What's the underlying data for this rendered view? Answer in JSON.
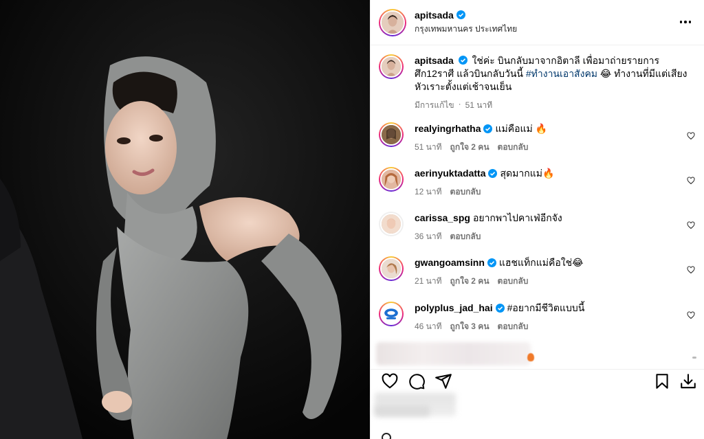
{
  "post": {
    "username": "apitsada",
    "location": "กรุงเทพมหานคร ประเทศไทย",
    "more_icon": "more-horizontal-icon"
  },
  "caption": {
    "username": "apitsada",
    "text_before": "ใช่ค่ะ บินกลับมาจากอิตาลี เพื่อมาถ่ายรายการศึก12ราศี แล้วบินกลับวันนี้ ",
    "hashtag": "#ทำงานเอาสังคม",
    "text_after": " 😂 ทำงานที่มีแต่เสียงหัวเราะตั้งแต่เช้าจนเย็น",
    "edited": "มีการแก้ไข",
    "time": "51 นาที"
  },
  "comments": [
    {
      "username": "realyingrhatha",
      "verified": true,
      "text": "แม่คือแม่ 🔥",
      "time": "51 นาที",
      "likes": "ถูกใจ 2 คน",
      "reply": "ตอบกลับ",
      "avatar_color": "#7a5a3c"
    },
    {
      "username": "aerinyuktadatta",
      "verified": true,
      "text": "สุดมากแม่🔥",
      "time": "12 นาที",
      "likes": "",
      "reply": "ตอบกลับ",
      "avatar_color": "#b88464"
    },
    {
      "username": "carissa_spg",
      "verified": false,
      "text": "อยากพาไปคาเฟ่อีกจัง",
      "time": "36 นาที",
      "likes": "",
      "reply": "ตอบกลับ",
      "avatar_color": "#d9b59c"
    },
    {
      "username": "gwangoamsinn",
      "verified": true,
      "text": "แฮชแท็กแม่คือใช่😂",
      "time": "21 นาที",
      "likes": "ถูกใจ 2 คน",
      "reply": "ตอบกลับ",
      "avatar_color": "#c9a07e"
    },
    {
      "username": "polyplus_jad_hai",
      "verified": true,
      "text": "#อยากมีชีวิตแบบนี้",
      "time": "46 นาที",
      "likes": "ถูกใจ 3 คน",
      "reply": "ตอบกลับ",
      "avatar_color": "#1a6fd1",
      "text_is_hashtag": true
    }
  ],
  "actions": {
    "like_icon": "heart-icon",
    "comment_icon": "comment-icon",
    "share_icon": "share-icon",
    "save_icon": "bookmark-icon",
    "download_icon": "download-icon"
  },
  "colors": {
    "verified": "#0095f6",
    "hashtag": "#00376b",
    "muted": "#737373"
  }
}
